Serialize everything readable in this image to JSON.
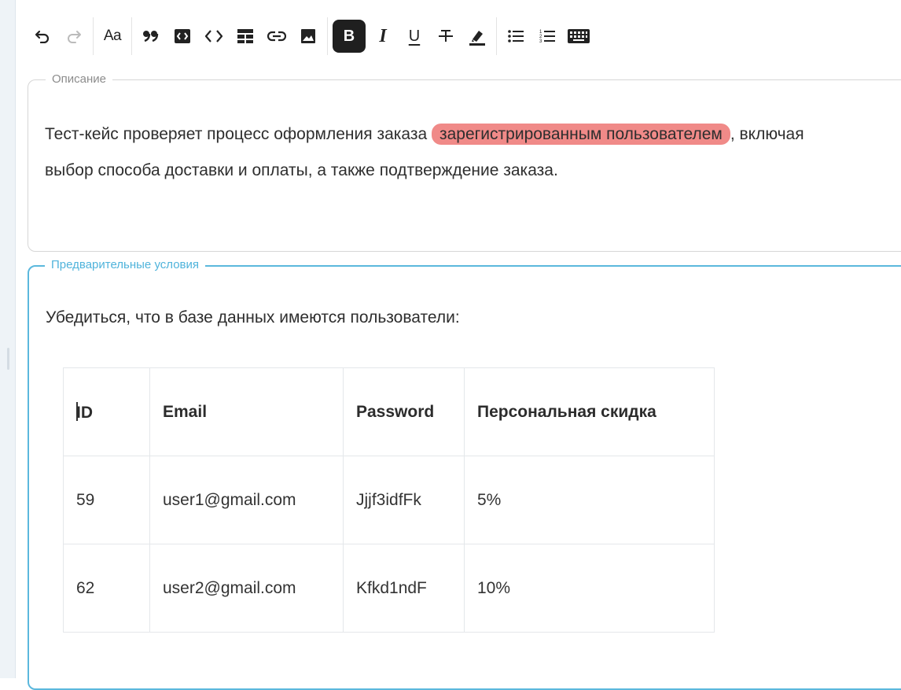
{
  "toolbar": {
    "undo_icon": "undo-icon",
    "redo_icon": "redo-icon",
    "font_size_label": "Aa",
    "bold_label": "B",
    "italic_label": "I",
    "underline_label": "U"
  },
  "description": {
    "legend": "Описание",
    "text_before": "Тест-кейс проверяет процесс оформления заказа ",
    "highlighted": "зарегистрированным пользователем",
    "text_after": ", включая выбор способа доставки и оплаты, а также подтверждение заказа.",
    "highlight_color": "#f08a88"
  },
  "preconditions": {
    "legend": "Предварительные условия",
    "text": "Убедиться, что в базе данных имеются пользователи:",
    "accent_color": "#5bb8dd",
    "table": {
      "headers": [
        "ID",
        "Email",
        "Password",
        "Персональная скидка"
      ],
      "rows": [
        [
          "59",
          "user1@gmail.com",
          "Jjjf3idfFk",
          "5%"
        ],
        [
          "62",
          "user2@gmail.com",
          "Kfkd1ndF",
          "10%"
        ]
      ]
    }
  }
}
